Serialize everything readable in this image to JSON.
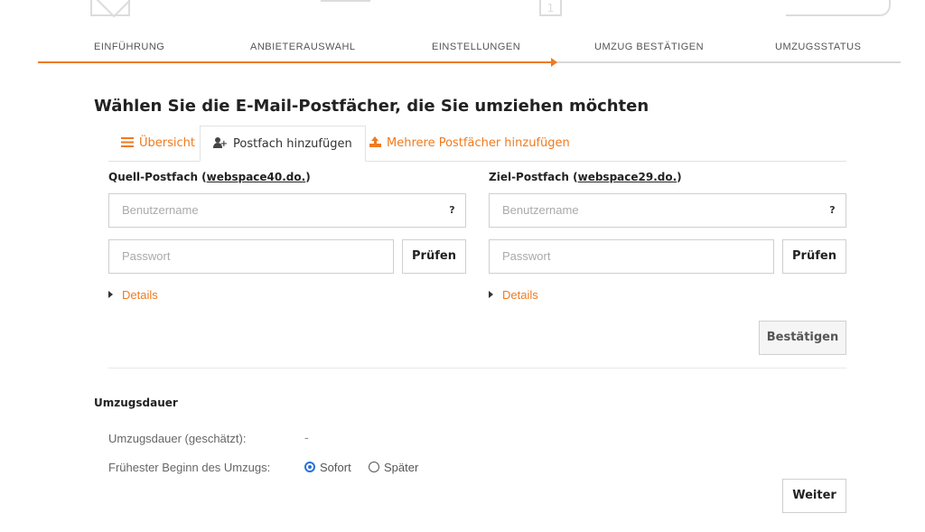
{
  "steps": [
    {
      "label": "EINFÜHRUNG"
    },
    {
      "label": "ANBIETERAUSWAHL"
    },
    {
      "label": "EINSTELLUNGEN"
    },
    {
      "label": "UMZUG BESTÄTIGEN"
    },
    {
      "label": "UMZUGSSTATUS"
    }
  ],
  "deco": {
    "num": "1"
  },
  "page_title": "Wählen Sie die E-Mail-Postfächer, die Sie umziehen möchten",
  "tabs": [
    {
      "label": "Übersicht",
      "icon": "list-icon"
    },
    {
      "label": "Postfach hinzufügen",
      "icon": "user-plus-icon"
    },
    {
      "label": "Mehrere Postfächer hinzufügen",
      "icon": "upload-icon"
    }
  ],
  "source": {
    "title": "Quell-Postfach (",
    "host": "webspace40.do.",
    "close": ")",
    "username_placeholder": "Benutzername",
    "password_placeholder": "Passwort",
    "help_label": "?",
    "check_label": "Prüfen",
    "details_label": "Details"
  },
  "target": {
    "title": "Ziel-Postfach (",
    "host": "webspace29.do.",
    "close": ")",
    "username_placeholder": "Benutzername",
    "password_placeholder": "Passwort",
    "help_label": "?",
    "check_label": "Prüfen",
    "details_label": "Details"
  },
  "confirm_label": "Bestätigen",
  "duration": {
    "section_title": "Umzugsdauer",
    "estimated_label": "Umzugsdauer (geschätzt):",
    "estimated_value": "-",
    "start_label": "Frühester Beginn des Umzugs:",
    "option_now": "Sofort",
    "option_later": "Später",
    "selected": "Sofort"
  },
  "next_label": "Weiter",
  "colors": {
    "accent": "#f07a1e",
    "radio": "#2a72d4"
  }
}
